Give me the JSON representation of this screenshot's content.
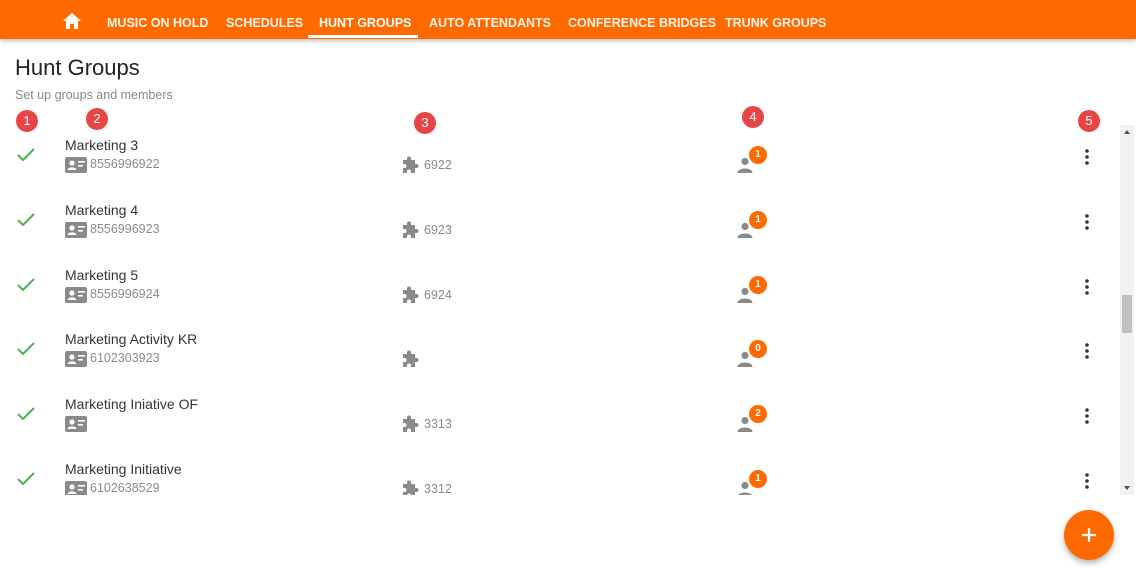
{
  "nav": {
    "home_icon": "home-icon",
    "tabs": [
      {
        "label": "MUSIC ON HOLD",
        "active": false
      },
      {
        "label": "SCHEDULES",
        "active": false
      },
      {
        "label": "HUNT GROUPS",
        "active": true
      },
      {
        "label": "AUTO ATTENDANTS",
        "active": false
      },
      {
        "label": "CONFERENCE BRIDGES",
        "active": false
      },
      {
        "label": "TRUNK GROUPS",
        "active": false
      }
    ]
  },
  "page": {
    "title": "Hunt Groups",
    "subtitle": "Set up groups and members"
  },
  "markers": [
    "1",
    "2",
    "3",
    "4",
    "5"
  ],
  "rows": [
    {
      "name": "Marketing 3",
      "phone": "8556996922",
      "extension": "6922",
      "members": "1"
    },
    {
      "name": "Marketing 4",
      "phone": "8556996923",
      "extension": "6923",
      "members": "1"
    },
    {
      "name": "Marketing 5",
      "phone": "8556996924",
      "extension": "6924",
      "members": "1"
    },
    {
      "name": "Marketing Activity KR",
      "phone": "6102303923",
      "extension": "",
      "members": "0"
    },
    {
      "name": "Marketing Iniative OF",
      "phone": "",
      "extension": "3313",
      "members": "2"
    },
    {
      "name": "Marketing Initiative",
      "phone": "6102638529",
      "extension": "3312",
      "members": "1"
    }
  ],
  "colors": {
    "brand": "#ff6a00",
    "marker": "#e64545",
    "check": "#4caf50",
    "icon_gray": "#8a8a8a"
  },
  "fab_icon": "plus-icon"
}
